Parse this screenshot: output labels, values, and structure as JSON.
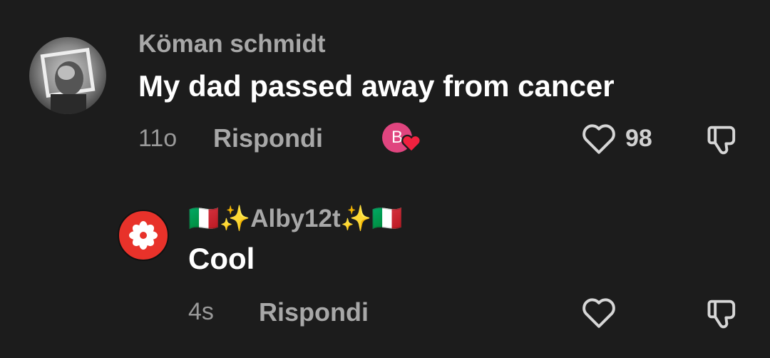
{
  "comments": [
    {
      "username": "Köman schmidt",
      "text": "My dad passed away from cancer",
      "time": "11o",
      "reply_label": "Rispondi",
      "creator_like_initial": "B",
      "like_count": "98",
      "icons": [
        "avatar-photo",
        "heart-outline-icon",
        "thumbs-down-icon",
        "creator-heart-badge-icon"
      ]
    },
    {
      "username_flag_left": "🇮🇹",
      "username_sparkle_left": "✨",
      "username": "Alby12t",
      "username_sparkle_right": "✨",
      "username_flag_right": "🇮🇹",
      "text": "Cool",
      "time": "4s",
      "reply_label": "Rispondi",
      "icons": [
        "flower-avatar",
        "heart-outline-icon",
        "thumbs-down-icon"
      ]
    }
  ],
  "colors": {
    "background": "#1c1c1c",
    "badge_pink": "#e0457f",
    "heart_red": "#f2213f",
    "avatar_red": "#e8322a"
  }
}
